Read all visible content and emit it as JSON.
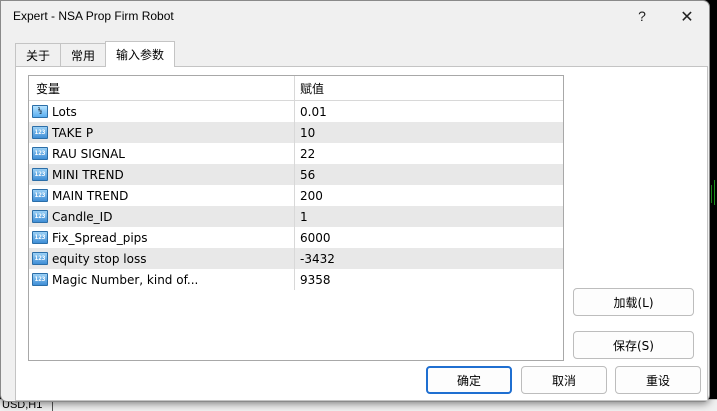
{
  "window": {
    "title": "Expert - NSA Prop Firm Robot",
    "help_glyph": "?",
    "close_glyph": "✕"
  },
  "tabs": [
    {
      "label": "关于",
      "active": false
    },
    {
      "label": "常用",
      "active": false
    },
    {
      "label": "输入参数",
      "active": true
    }
  ],
  "table": {
    "headers": {
      "variable": "变量",
      "value": "赋值"
    },
    "rows": [
      {
        "icon": "half-icon",
        "icon_text": "½",
        "name": "Lots",
        "value": "0.01"
      },
      {
        "icon": "int-icon",
        "icon_text": "123",
        "name": "TAKE P",
        "value": "10"
      },
      {
        "icon": "int-icon",
        "icon_text": "123",
        "name": "RAU SIGNAL",
        "value": "22"
      },
      {
        "icon": "int-icon",
        "icon_text": "123",
        "name": "MINI TREND",
        "value": "56"
      },
      {
        "icon": "int-icon",
        "icon_text": "123",
        "name": "MAIN TREND",
        "value": "200"
      },
      {
        "icon": "int-icon",
        "icon_text": "123",
        "name": "Candle_ID",
        "value": "1"
      },
      {
        "icon": "int-icon",
        "icon_text": "123",
        "name": "Fix_Spread_pips",
        "value": "6000"
      },
      {
        "icon": "int-icon",
        "icon_text": "123",
        "name": "equity stop loss",
        "value": "-3432"
      },
      {
        "icon": "int-icon",
        "icon_text": "123",
        "name": "Magic Number, kind of...",
        "value": "9358"
      }
    ]
  },
  "buttons": {
    "load": "加载(L)",
    "save": "保存(S)",
    "ok": "确定",
    "cancel": "取消",
    "reset": "重设"
  },
  "background": {
    "status_text": "USD,H1"
  },
  "colors": {
    "accent": "#1f6fd1",
    "row_alt": "#e8e8e8",
    "chart_tick": "#1e9a1e"
  }
}
